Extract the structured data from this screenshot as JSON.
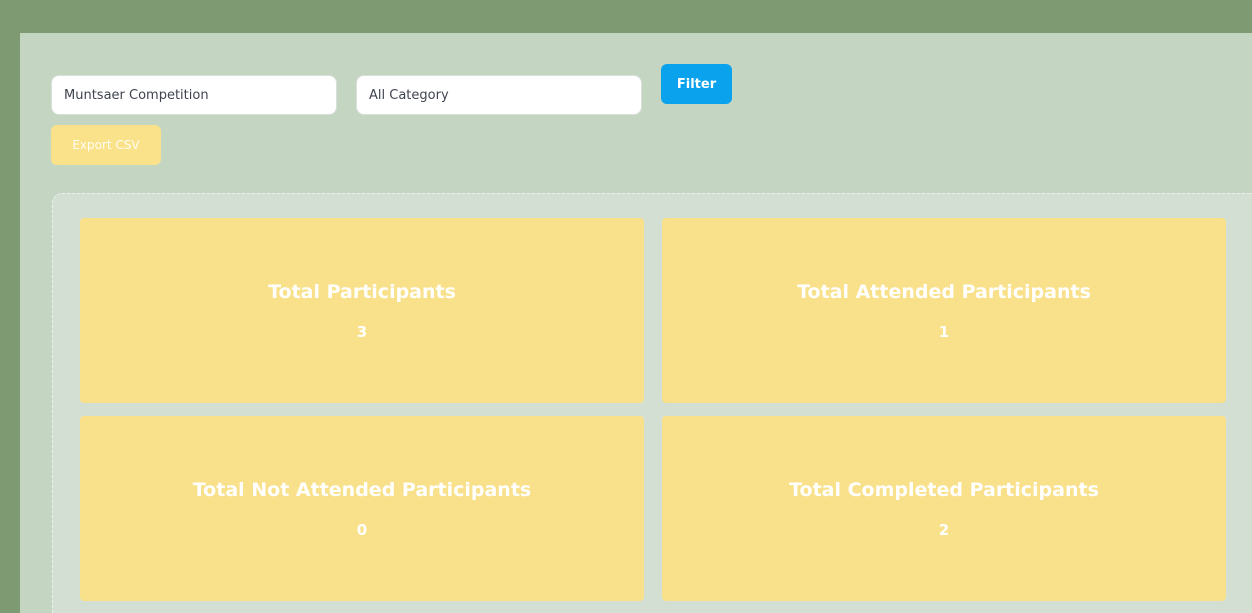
{
  "filters": {
    "competition_value": "Muntsaer Competition",
    "category_value": "All Category",
    "filter_label": "Filter",
    "export_label": "Export CSV"
  },
  "stats": [
    {
      "title": "Total Participants",
      "value": "3"
    },
    {
      "title": "Total Attended Participants",
      "value": "1"
    },
    {
      "title": "Total Not Attended Participants",
      "value": "0"
    },
    {
      "title": "Total Completed Participants",
      "value": "2"
    }
  ],
  "colors": {
    "outer_background": "#7e9a72",
    "content_background": "#c4d6c2",
    "panel_background": "#d3dfd3",
    "card_background": "#f8e18a",
    "filter_button": "#0aa2ec",
    "export_button": "#f9e28a"
  }
}
